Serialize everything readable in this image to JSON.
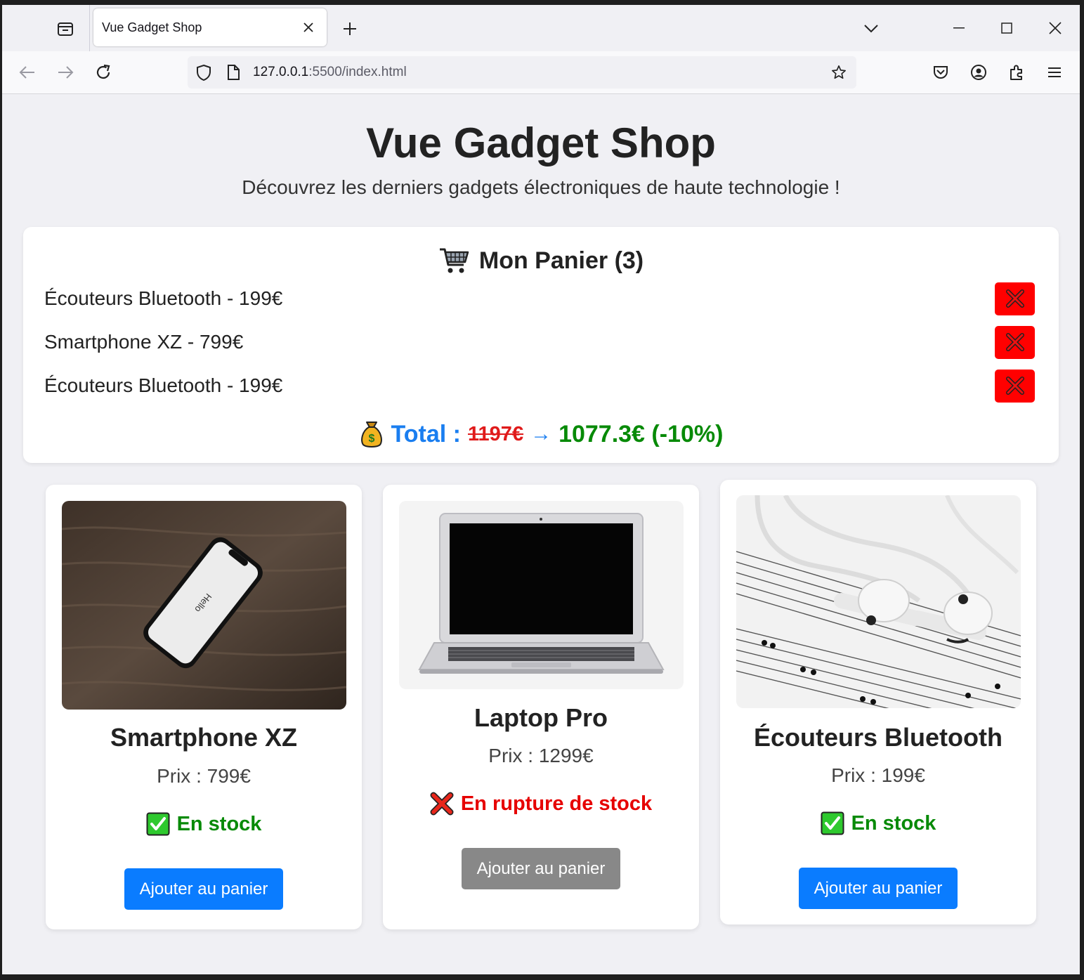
{
  "browser": {
    "tab_title": "Vue Gadget Shop",
    "url_host": "127.0.0.1",
    "url_rest": ":5500/index.html"
  },
  "page": {
    "title": "Vue Gadget Shop",
    "subtitle": "Découvrez les derniers gadgets électroniques de haute technologie !"
  },
  "cart": {
    "title": "Mon Panier (3)",
    "items": [
      {
        "label": "Écouteurs Bluetooth - 199€"
      },
      {
        "label": "Smartphone XZ - 799€"
      },
      {
        "label": "Écouteurs Bluetooth - 199€"
      }
    ],
    "total_label": "Total :",
    "total_original": "1197€",
    "total_arrow": "→",
    "total_discounted": "1077.3€ (-10%)"
  },
  "products": [
    {
      "name": "Smartphone XZ",
      "price": "Prix : 799€",
      "stock": "En stock",
      "in_stock": true,
      "button": "Ajouter au panier"
    },
    {
      "name": "Laptop Pro",
      "price": "Prix : 1299€",
      "stock": "En rupture de stock",
      "in_stock": false,
      "button": "Ajouter au panier"
    },
    {
      "name": "Écouteurs Bluetooth",
      "price": "Prix : 199€",
      "stock": "En stock",
      "in_stock": true,
      "button": "Ajouter au panier"
    }
  ],
  "colors": {
    "accent_blue": "#0a7cff",
    "in_stock_green": "#078a07",
    "out_of_stock_red": "#e60000",
    "remove_red": "#ff0000",
    "disabled_gray": "#888888"
  },
  "icons": {
    "cart": "shopping-cart-icon",
    "money_bag": "money-bag-icon",
    "check": "check-mark-icon",
    "cross": "cross-mark-icon",
    "remove": "remove-x-icon"
  }
}
